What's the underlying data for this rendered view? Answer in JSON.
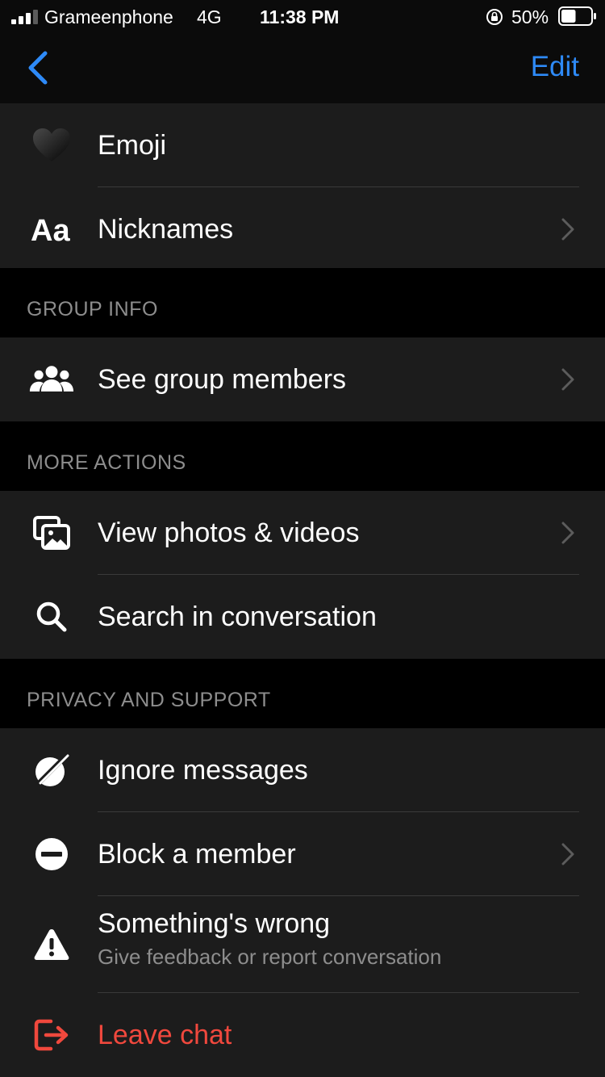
{
  "status_bar": {
    "carrier": "Grameenphone",
    "network": "4G",
    "time": "11:38 PM",
    "battery_percent": "50%",
    "battery_level": 0.5
  },
  "nav": {
    "back_icon": "chevron-left-icon",
    "edit_label": "Edit"
  },
  "colors": {
    "accent": "#2e8af7",
    "danger": "#f0483d",
    "background": "#000000",
    "row_background": "#1c1c1c",
    "secondary_text": "#8d8d8d"
  },
  "top_group": {
    "items": [
      {
        "label": "Emoji",
        "icon": "black-heart-icon"
      },
      {
        "label": "Nicknames",
        "icon": "text-aa-icon",
        "chevron": true
      }
    ]
  },
  "group_info": {
    "header": "GROUP INFO",
    "items": [
      {
        "label": "See group members",
        "icon": "people-icon",
        "chevron": true
      }
    ]
  },
  "more_actions": {
    "header": "MORE ACTIONS",
    "items": [
      {
        "label": "View photos & videos",
        "icon": "photos-icon",
        "chevron": true
      },
      {
        "label": "Search in conversation",
        "icon": "search-icon"
      }
    ]
  },
  "privacy_support": {
    "header": "PRIVACY AND SUPPORT",
    "items": [
      {
        "label": "Ignore messages",
        "icon": "ignore-icon"
      },
      {
        "label": "Block a member",
        "icon": "block-icon",
        "chevron": true
      },
      {
        "label": "Something's wrong",
        "sublabel": "Give feedback or report conversation",
        "icon": "warning-icon"
      },
      {
        "label": "Leave chat",
        "icon": "leave-icon"
      }
    ]
  }
}
